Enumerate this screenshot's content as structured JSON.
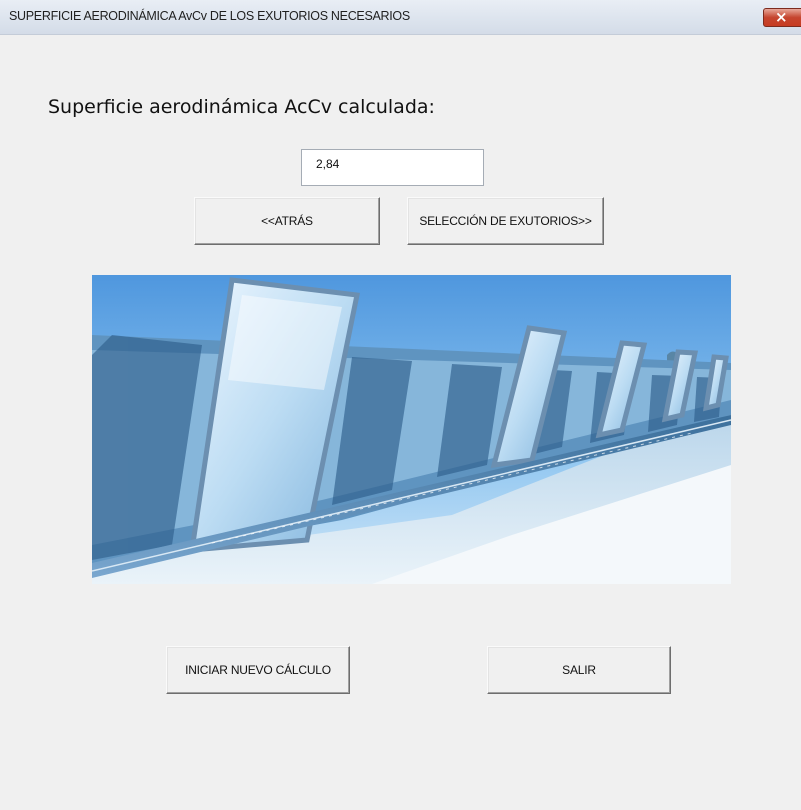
{
  "window": {
    "title": "SUPERFICIE AERODINÁMICA AvCv DE LOS EXUTORIOS NECESARIOS",
    "close_icon": "close-icon"
  },
  "main": {
    "heading": "Superficie aerodinámica AcCv calculada:",
    "result_value": "2,84",
    "back_label": "<<ATRÁS",
    "select_vents_label": "SELECCIÓN DE EXUTORIOS>>",
    "new_calc_label": "INICIAR NUEVO CÁLCULO",
    "exit_label": "SALIR"
  },
  "colors": {
    "background": "#f0f0f0",
    "close_button": "#c73c22",
    "sky": "#6fb0e8"
  }
}
